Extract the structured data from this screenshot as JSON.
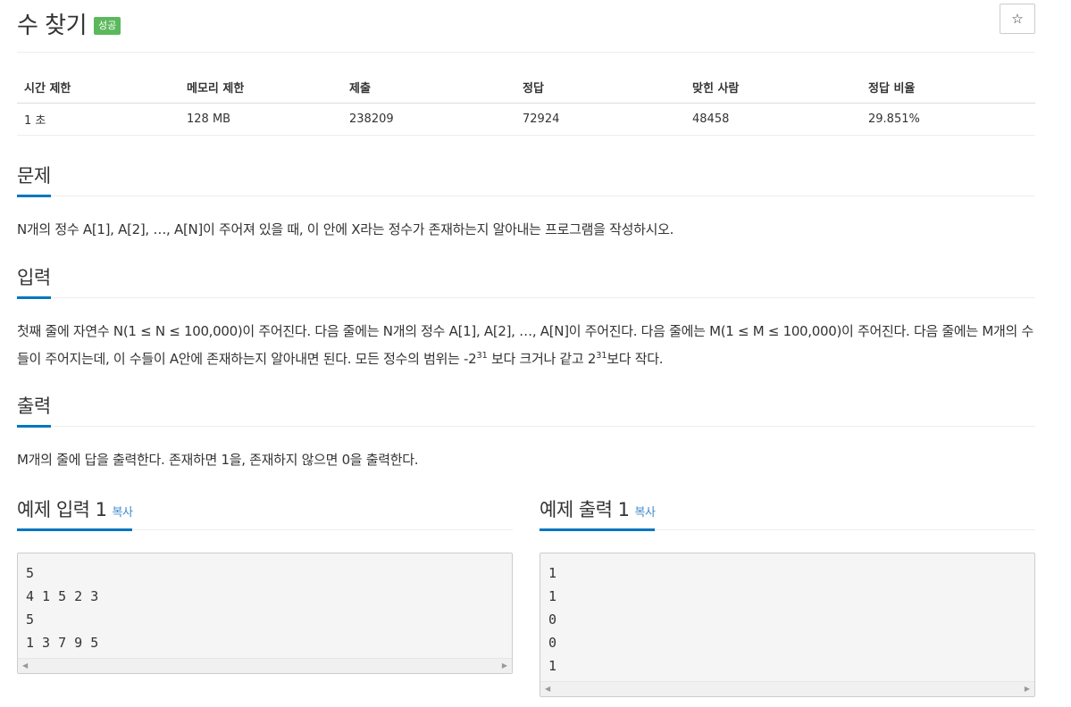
{
  "problem": {
    "title": "수 찾기",
    "badge": "성공",
    "star_icon": "☆"
  },
  "info_table": {
    "headers": [
      "시간 제한",
      "메모리 제한",
      "제출",
      "정답",
      "맞힌 사람",
      "정답 비율"
    ],
    "values": [
      "1 초",
      "128 MB",
      "238209",
      "72924",
      "48458",
      "29.851%"
    ]
  },
  "sections": {
    "description": {
      "heading": "문제",
      "text": "N개의 정수 A[1], A[2], …, A[N]이 주어져 있을 때, 이 안에 X라는 정수가 존재하는지 알아내는 프로그램을 작성하시오."
    },
    "input": {
      "heading": "입력",
      "text_1": "첫째 줄에 자연수 N(1 ≤ N ≤ 100,000)이 주어진다. 다음 줄에는 N개의 정수 A[1], A[2], …, A[N]이 주어진다. 다음 줄에는 M(1 ≤ M ≤ 100,000)이 주어진다. 다음 줄에는 M개의 수들이 주어지는데, 이 수들이 A안에 존재하는지 알아내면 된다. 모든 정수의 범위는 -2",
      "sup_1": "31",
      "text_2": " 보다 크거나 같고 2",
      "sup_2": "31",
      "text_3": "보다 작다."
    },
    "output": {
      "heading": "출력",
      "text": "M개의 줄에 답을 출력한다. 존재하면 1을, 존재하지 않으면 0을 출력한다."
    }
  },
  "samples": {
    "input": {
      "heading": "예제 입력 1",
      "copy_label": "복사",
      "content": "5\n4 1 5 2 3\n5\n1 3 7 9 5"
    },
    "output": {
      "heading": "예제 출력 1",
      "copy_label": "복사",
      "content": "1\n1\n0\n0\n1"
    }
  },
  "colors": {
    "accent": "#0076c0",
    "badge_success": "#5cb85c",
    "link": "#428bca"
  }
}
